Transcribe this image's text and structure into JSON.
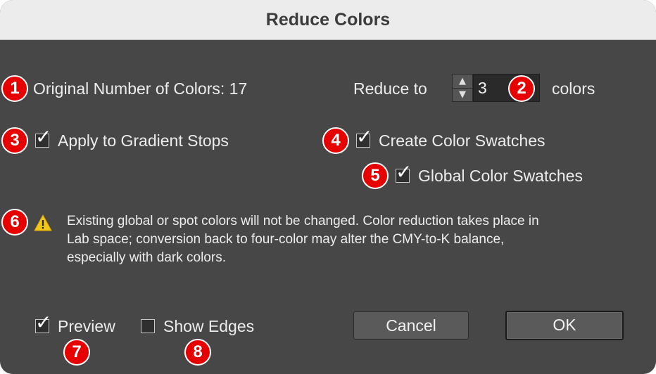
{
  "window": {
    "title": "Reduce Colors"
  },
  "original": {
    "label": "Original Number of Colors: 17"
  },
  "reduce": {
    "label": "Reduce to",
    "value": "3",
    "unit": "colors"
  },
  "options": {
    "apply_gradient": {
      "label": "Apply to Gradient Stops",
      "checked": true
    },
    "create_swatches": {
      "label": "Create Color Swatches",
      "checked": true
    },
    "global_swatches": {
      "label": "Global Color Swatches",
      "checked": true
    }
  },
  "warning": {
    "icon": "warning-icon",
    "lines": [
      "Existing global or spot colors will not be changed. Color reduction takes place in",
      "Lab space; conversion back to four-color may alter the CMY-to-K balance,",
      "especially with dark colors."
    ]
  },
  "footer": {
    "preview": {
      "label": "Preview",
      "checked": true
    },
    "show_edges": {
      "label": "Show Edges",
      "checked": false
    },
    "cancel_label": "Cancel",
    "ok_label": "OK"
  },
  "badges": [
    "1",
    "2",
    "3",
    "4",
    "5",
    "6",
    "7",
    "8"
  ],
  "icons": {
    "stepper_up": "▲",
    "stepper_down": "▼",
    "check": "✓"
  },
  "colors": {
    "badge": "#e60000",
    "dialog_bg": "#474747",
    "titlebar_bg": "#ececec",
    "text": "#ececec"
  }
}
